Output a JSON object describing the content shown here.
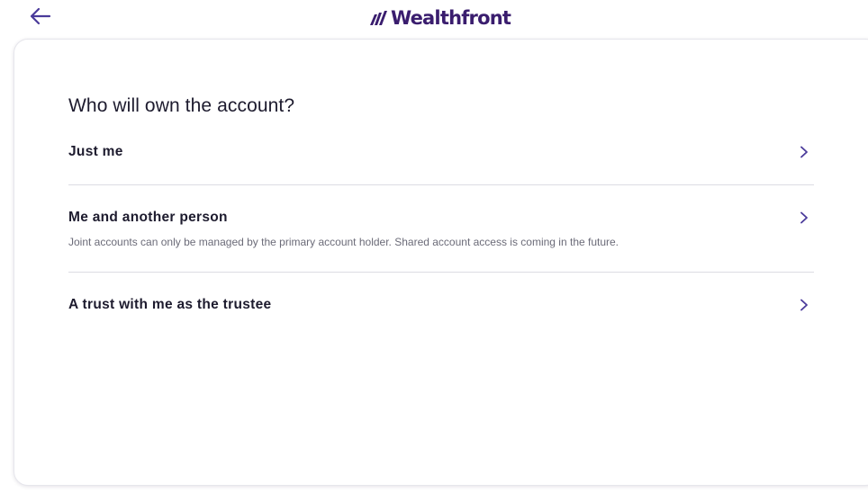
{
  "header": {
    "logo_text": "Wealthfront",
    "back_icon": "arrow-left-icon",
    "brand_color": "#3a1d6e",
    "accent_color": "#4a3a9a"
  },
  "main": {
    "title": "Who will own the account?",
    "options": [
      {
        "label": "Just me",
        "description": "",
        "icon": "chevron-right-icon"
      },
      {
        "label": "Me and another person",
        "description": "Joint accounts can only be managed by the primary account holder. Shared account access is coming in the future.",
        "icon": "chevron-right-icon"
      },
      {
        "label": "A trust with me as the trustee",
        "description": "",
        "icon": "chevron-right-icon"
      }
    ]
  }
}
